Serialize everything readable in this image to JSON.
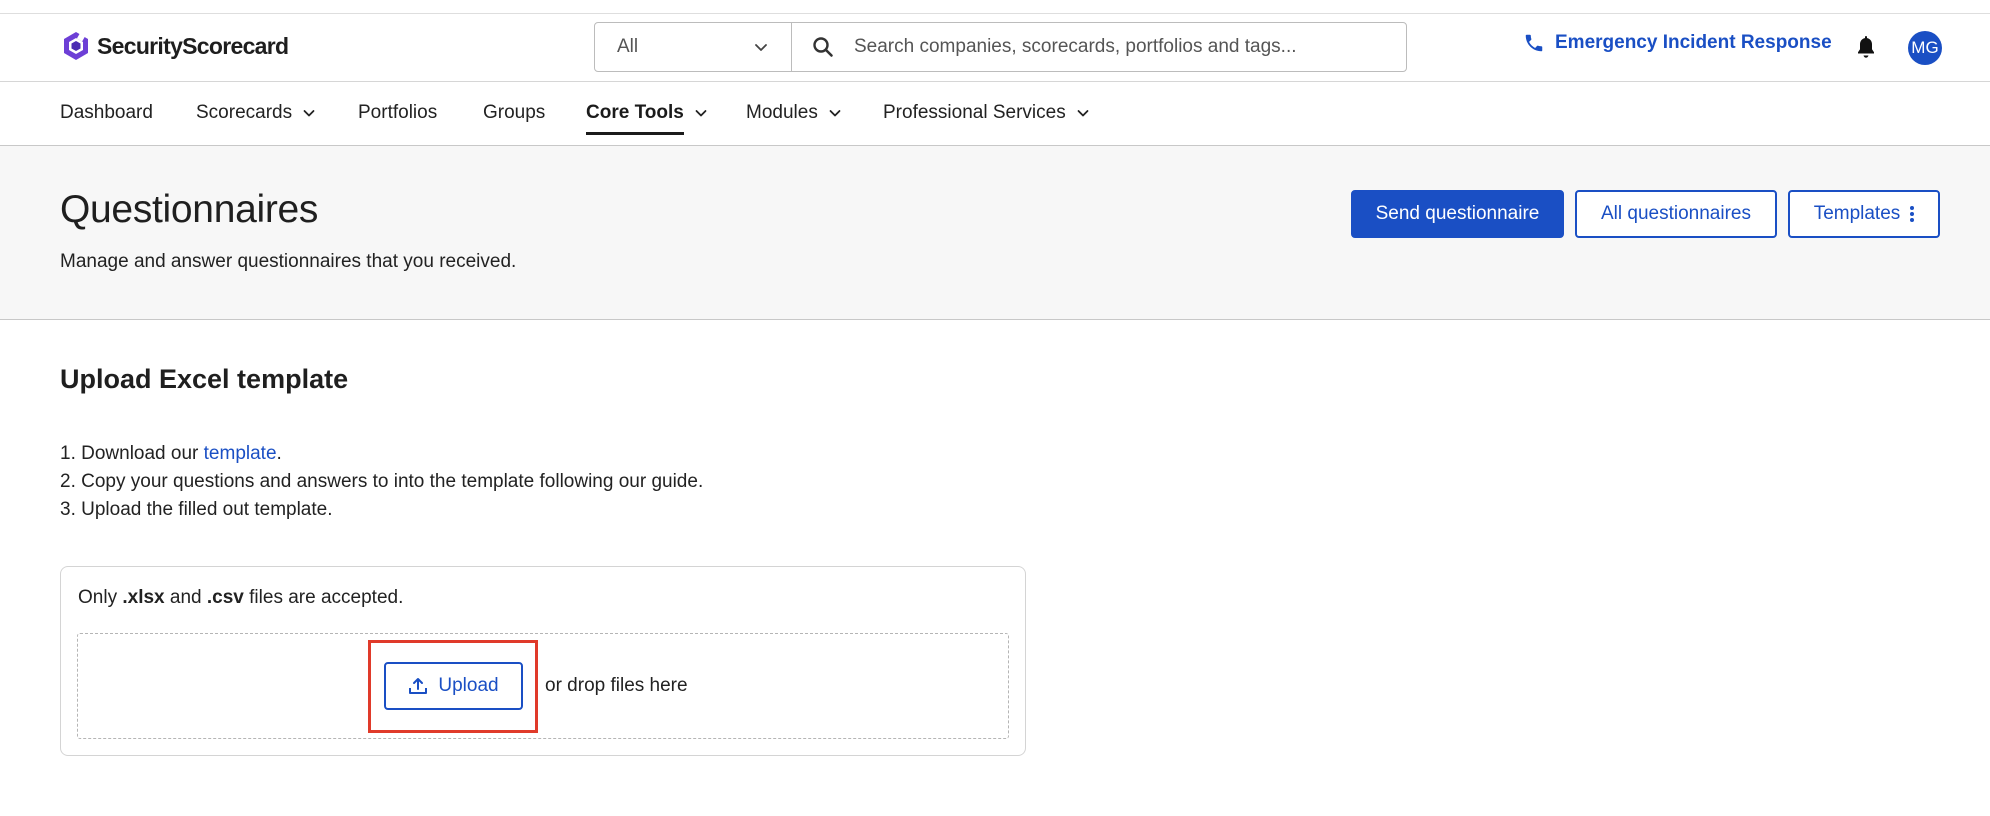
{
  "header": {
    "logo_text": "SecurityScorecard",
    "search": {
      "scope_value": "All",
      "placeholder": "Search companies, scorecards, portfolios and tags..."
    },
    "emergency_label": "Emergency Incident Response",
    "avatar_initials": "MG"
  },
  "nav": {
    "items": [
      {
        "label": "Dashboard"
      },
      {
        "label": "Scorecards"
      },
      {
        "label": "Portfolios"
      },
      {
        "label": "Groups"
      },
      {
        "label": "Core Tools"
      },
      {
        "label": "Modules"
      },
      {
        "label": "Professional Services"
      }
    ],
    "active_item": "Core Tools"
  },
  "page": {
    "title": "Questionnaires",
    "subtitle": "Manage and answer questionnaires that you received.",
    "buttons": {
      "send": "Send questionnaire",
      "all": "All questionnaires",
      "templates": "Templates"
    }
  },
  "upload": {
    "section_title": "Upload Excel template",
    "steps": {
      "step1_prefix": "1. Download our ",
      "step1_link": "template",
      "step1_suffix": ".",
      "step2": "2. Copy your questions and answers to into the template following our guide.",
      "step3": "3. Upload the filled out template."
    },
    "accepted": {
      "prefix": "Only ",
      "ext1": ".xlsx",
      "middle": " and ",
      "ext2": ".csv",
      "suffix": " files are accepted."
    },
    "button_label": "Upload",
    "drop_text": "or drop files here"
  },
  "colors": {
    "accent": "#1a4fc4",
    "highlight": "#e03a2a",
    "band_background": "#f7f7f7"
  },
  "icons": [
    "logo-icon",
    "chevron-down-icon",
    "search-icon",
    "phone-icon",
    "bell-icon",
    "kebab-icon",
    "upload-icon"
  ]
}
